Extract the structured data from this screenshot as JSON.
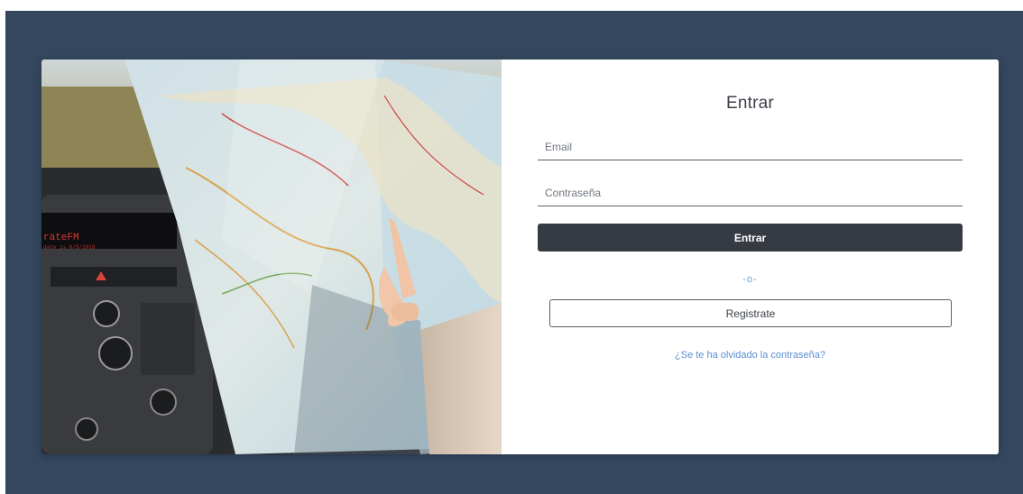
{
  "login": {
    "title": "Entrar",
    "email_placeholder": "Email",
    "password_placeholder": "Contraseña",
    "submit_label": "Entrar",
    "separator": "-o-",
    "register_label": "Registrate",
    "forgot_label": "¿Se te ha olvidado la contraseña?"
  },
  "photo": {
    "radio_display": "rateFM",
    "radio_display_date": "date is 6/5/2018"
  },
  "colors": {
    "page_background": "#34475f",
    "primary_button": "#363b43",
    "link": "#5b8fd2"
  }
}
